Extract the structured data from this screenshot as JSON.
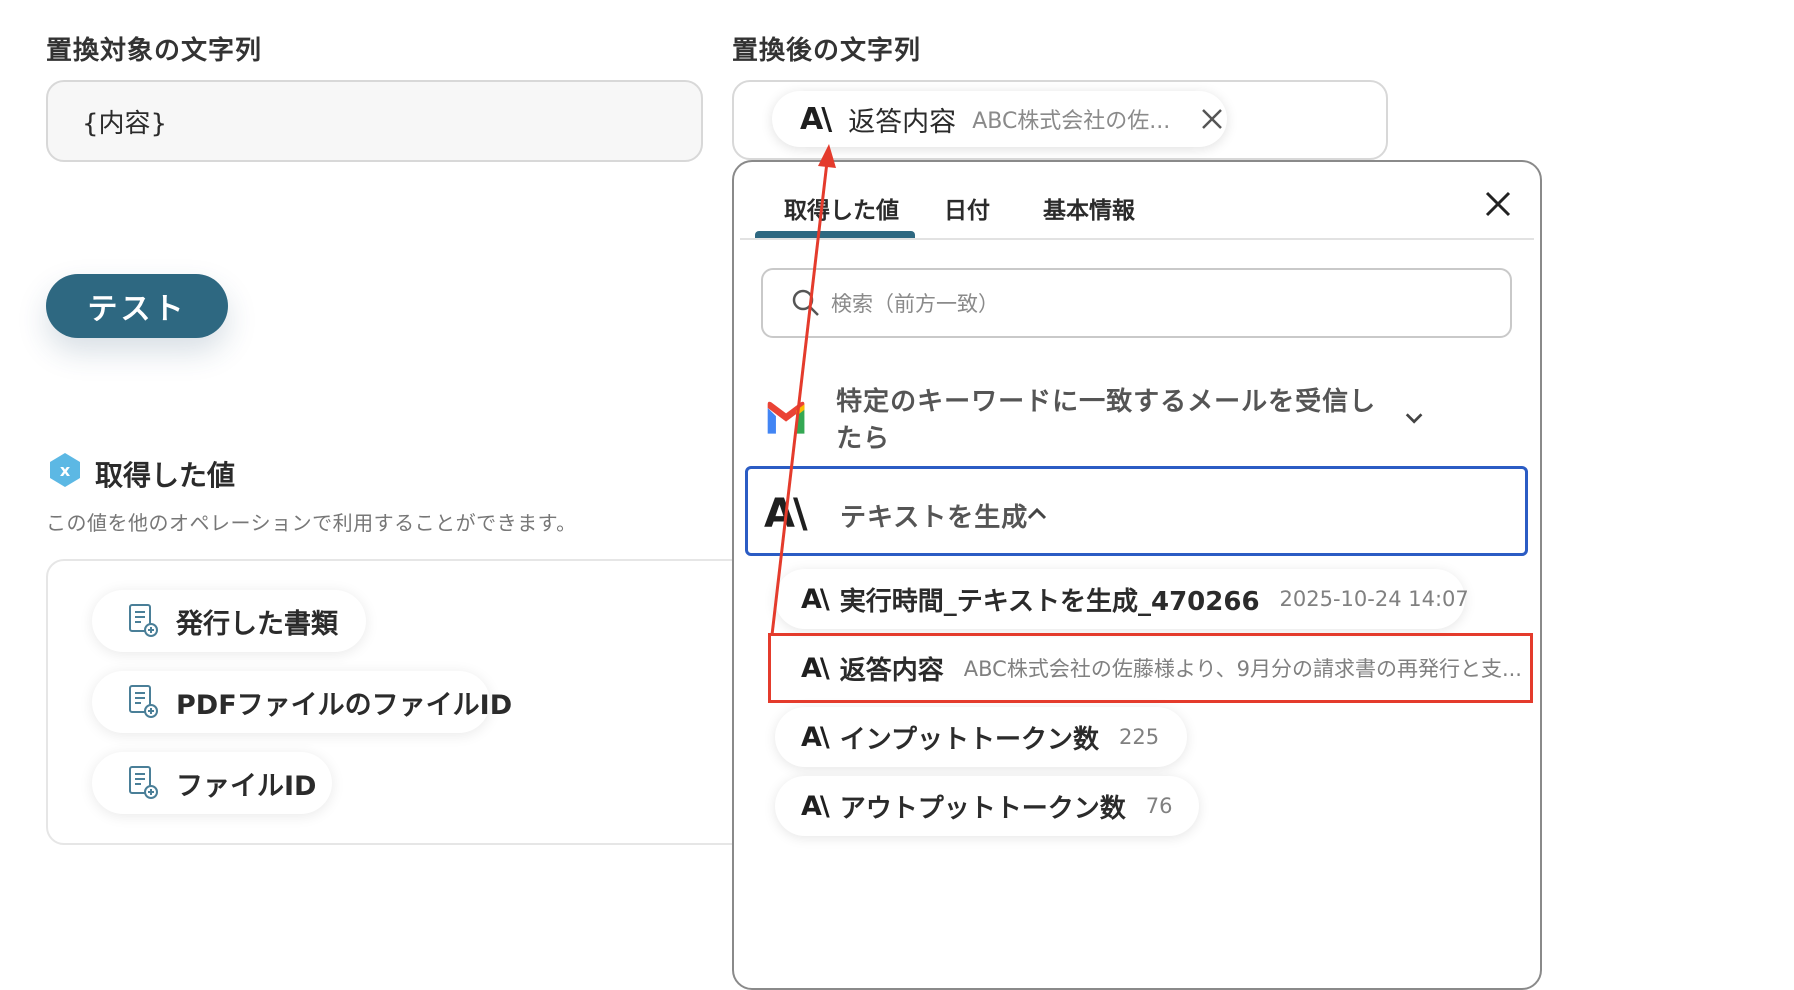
{
  "left": {
    "target_label": "置換対象の文字列",
    "target_value": "{内容}",
    "test_button": "テスト",
    "section_title": "取得した値",
    "section_desc": "この値を他のオペレーションで利用することができます。",
    "values": [
      {
        "label": "発行した書類"
      },
      {
        "label": "PDFファイルのファイルID"
      },
      {
        "label": "ファイルID"
      }
    ]
  },
  "right": {
    "replacement_label": "置換後の文字列",
    "chip": {
      "logo": "A\\",
      "title": "返答内容",
      "preview": "ABC株式会社の佐..."
    },
    "dropdown": {
      "tabs": [
        "取得した値",
        "日付",
        "基本情報"
      ],
      "active_tab": 0,
      "search_placeholder": "検索（前方一致）",
      "groups": [
        {
          "title": "特定のキーワードに一致するメールを受信したら",
          "icon": "gmail-icon",
          "expanded": false
        },
        {
          "title": "テキストを生成",
          "icon": "anthropic-icon",
          "expanded": true
        }
      ],
      "items": [
        {
          "name": "実行時間_テキストを生成_470266",
          "value": "2025-10-24 14:07"
        },
        {
          "name": "返答内容",
          "value": "ABC株式会社の佐藤様より、9月分の請求書の再発行と支..."
        },
        {
          "name": "インプットトークン数",
          "value": "225"
        },
        {
          "name": "アウトプットトークン数",
          "value": "76"
        }
      ]
    }
  },
  "colors": {
    "primary": "#2e6881",
    "selected_border": "#2b5cc4",
    "annotation_red": "#e43b2c"
  }
}
